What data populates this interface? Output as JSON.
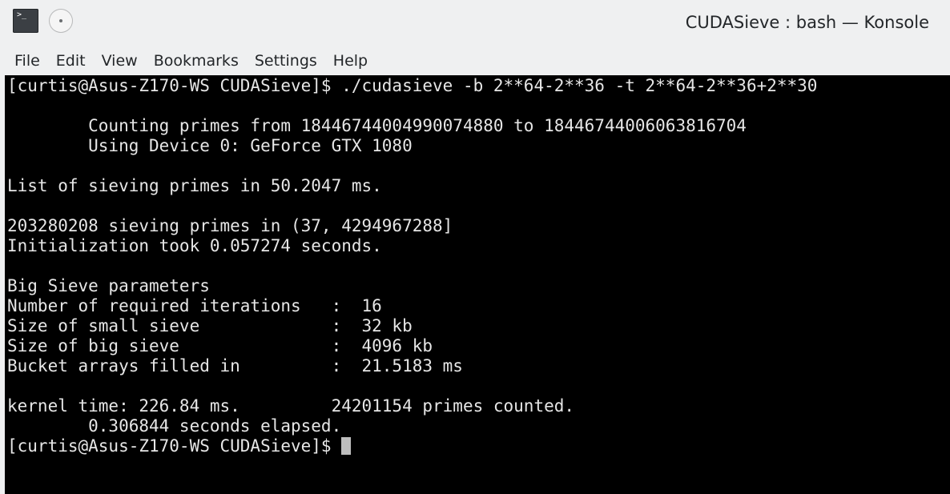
{
  "window": {
    "title": "CUDASieve : bash — Konsole",
    "app_icon": "terminal-icon",
    "app_icon_glyph": ">_",
    "pin_icon": "pin-icon"
  },
  "menu": {
    "items": [
      "File",
      "Edit",
      "View",
      "Bookmarks",
      "Settings",
      "Help"
    ]
  },
  "terminal": {
    "background": "#000000",
    "foreground": "#e6e6e6",
    "lines": [
      "[curtis@Asus-Z170-WS CUDASieve]$ ./cudasieve -b 2**64-2**36 -t 2**64-2**36+2**30",
      "",
      "        Counting primes from 18446744004990074880 to 18446744006063816704",
      "        Using Device 0: GeForce GTX 1080",
      "",
      "List of sieving primes in 50.2047 ms.",
      "",
      "203280208 sieving primes in (37, 4294967288]",
      "Initialization took 0.057274 seconds.",
      "",
      "Big Sieve parameters",
      "Number of required iterations   :  16",
      "Size of small sieve             :  32 kb",
      "Size of big sieve               :  4096 kb",
      "Bucket arrays filled in         :  21.5183 ms",
      "",
      "kernel time: 226.84 ms.         24201154 primes counted.",
      "        0.306844 seconds elapsed."
    ],
    "prompt": "[curtis@Asus-Z170-WS CUDASieve]$ "
  }
}
